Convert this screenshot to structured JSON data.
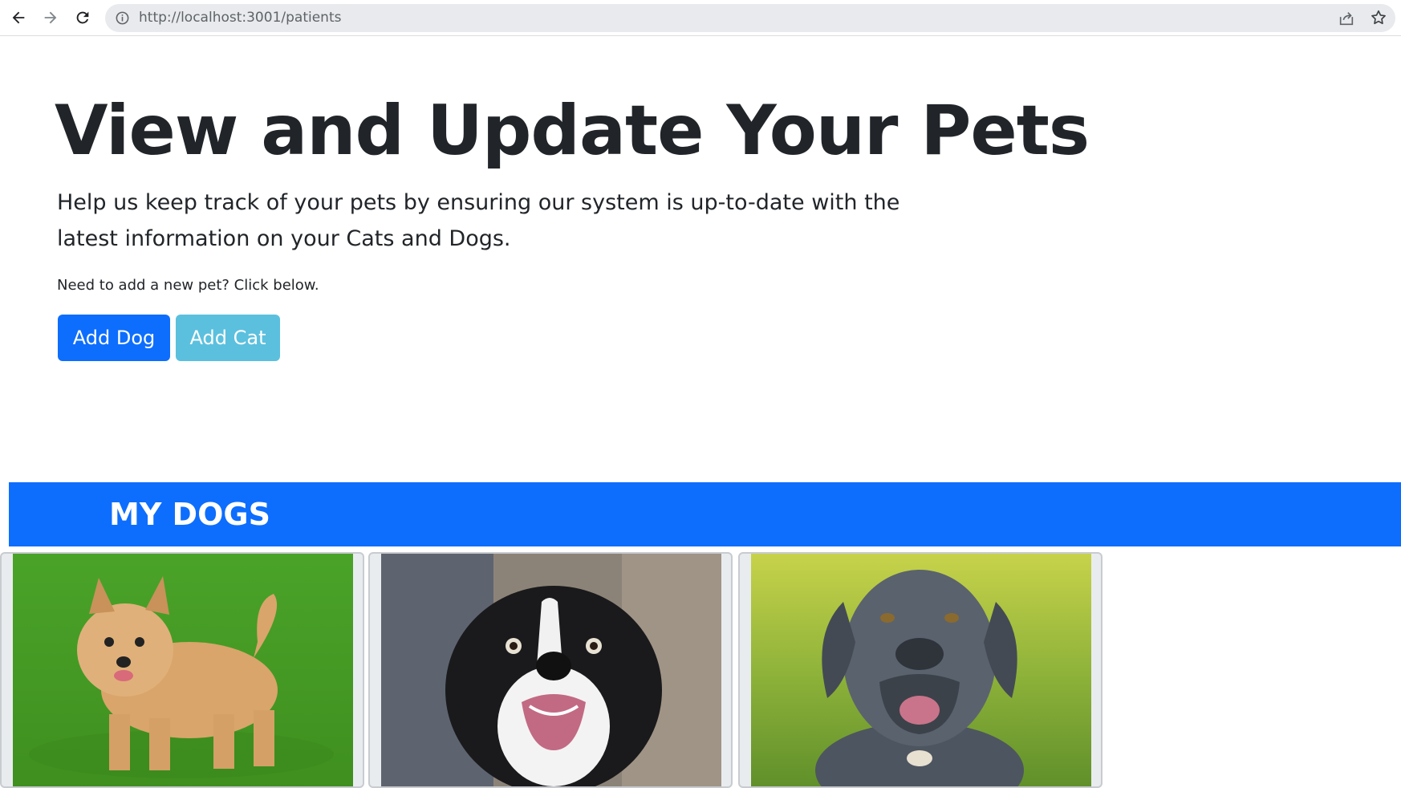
{
  "browser": {
    "url": "http://localhost:3001/patients",
    "icons": [
      "back-arrow-icon",
      "forward-arrow-icon",
      "reload-icon",
      "info-icon",
      "share-icon",
      "bookmark-star-icon"
    ]
  },
  "hero": {
    "title": "View and Update Your Pets",
    "lead": "Help us keep track of your pets by ensuring our system is up-to-date with the latest information on your Cats and Dogs.",
    "note": "Need to add a new pet? Click below."
  },
  "actions": {
    "add_dog_label": "Add Dog",
    "add_cat_label": "Add Cat"
  },
  "dogs_section": {
    "title": "MY DOGS",
    "cards": [
      {
        "image": "terrier-on-grass-photo"
      },
      {
        "image": "black-white-border-collie-photo"
      },
      {
        "image": "gray-mastiff-photo"
      }
    ]
  },
  "colors": {
    "primary": "#0d6efd",
    "info": "#5bc0de",
    "text": "#212529"
  }
}
